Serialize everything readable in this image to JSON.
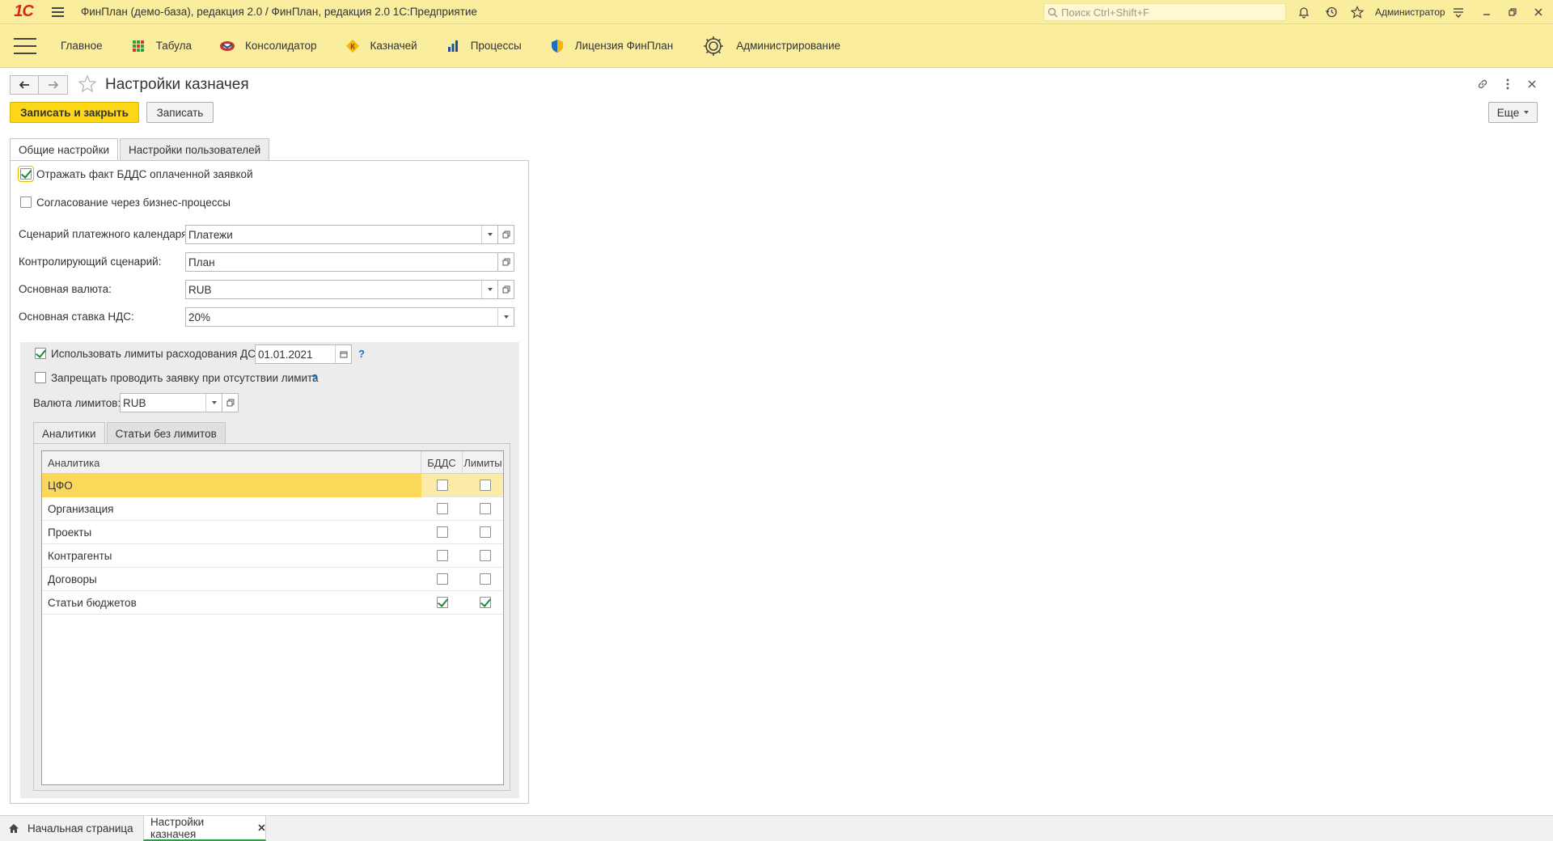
{
  "window": {
    "title": "ФинПлан (демо-база), редакция 2.0 / ФинПлан, редакция 2.0 1С:Предприятие",
    "search_placeholder": "Поиск Ctrl+Shift+F",
    "user": "Администратор"
  },
  "nav": {
    "items": [
      {
        "label": "Главное",
        "icon": "home"
      },
      {
        "label": "Табула",
        "icon": "tabula-icon"
      },
      {
        "label": "Консолидатор",
        "icon": "consolidator-icon"
      },
      {
        "label": "Казначей",
        "icon": "treasurer-icon"
      },
      {
        "label": "Процессы",
        "icon": "processes-icon"
      },
      {
        "label": "Лицензия ФинПлан",
        "icon": "license-shield-icon"
      },
      {
        "label": "Администрирование",
        "icon": "gear-icon"
      }
    ]
  },
  "form": {
    "title": "Настройки казначея",
    "save_close_label": "Записать и закрыть",
    "save_label": "Записать",
    "more_label": "Еще",
    "tabs": [
      "Общие настройки",
      "Настройки пользователей"
    ]
  },
  "general": {
    "cb_reflect_label": "Отражать факт БДДС оплаченной заявкой",
    "cb_reflect_checked": true,
    "cb_approval_label": "Согласование через бизнес-процессы",
    "cb_approval_checked": false,
    "payment_scenario_label": "Сценарий платежного календаря:",
    "payment_scenario_value": "Платежи",
    "control_scenario_label": "Контролирующий сценарий:",
    "control_scenario_value": "План",
    "currency_label": "Основная валюта:",
    "currency_value": "RUB",
    "vat_label": "Основная ставка НДС:",
    "vat_value": "20%"
  },
  "limits": {
    "use_limits_label": "Использовать лимиты расходования ДС",
    "use_limits_checked": true,
    "date_value": "01.01.2021",
    "forbid_label": "Запрещать проводить заявку при отсутствии лимита",
    "forbid_checked": false,
    "currency_label": "Валюта лимитов:",
    "currency_value": "RUB",
    "help": "?",
    "tabs": [
      "Аналитики",
      "Статьи без лимитов"
    ],
    "columns": [
      "Аналитика",
      "БДДС",
      "Лимиты"
    ],
    "rows": [
      {
        "name": "ЦФО",
        "bdds": false,
        "limits": false
      },
      {
        "name": "Организация",
        "bdds": false,
        "limits": false
      },
      {
        "name": "Проекты",
        "bdds": false,
        "limits": false
      },
      {
        "name": "Контрагенты",
        "bdds": false,
        "limits": false
      },
      {
        "name": "Договоры",
        "bdds": false,
        "limits": false
      },
      {
        "name": "Статьи бюджетов",
        "bdds": true,
        "limits": true
      }
    ]
  },
  "bottom": {
    "home_label": "Начальная страница",
    "current_label": "Настройки казначея"
  }
}
